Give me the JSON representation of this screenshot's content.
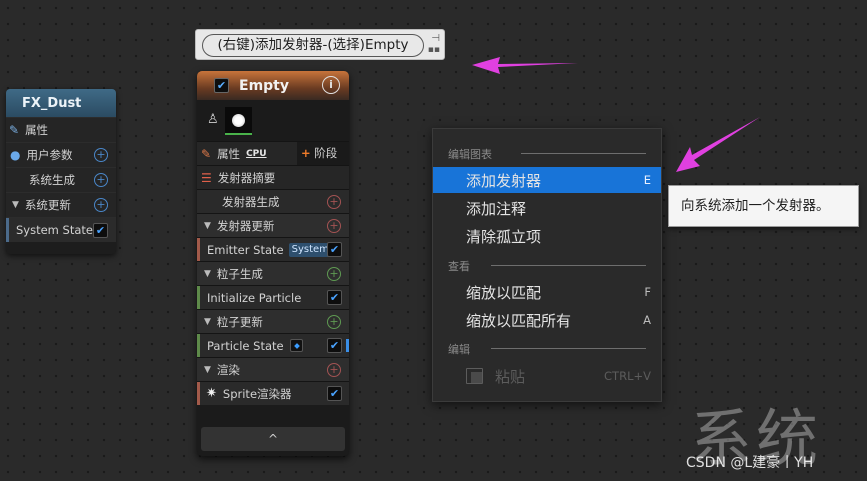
{
  "fx_node": {
    "title": "FX_Dust",
    "rows": [
      {
        "label": "属性",
        "icon": "pencil-icon"
      },
      {
        "label": "用户参数",
        "icon": "user-icon"
      },
      {
        "label": "系统生成"
      },
      {
        "label": "系统更新"
      },
      {
        "label": "System State"
      }
    ]
  },
  "tip_pill": {
    "text": "(右键)添加发射器-(选择)Empty"
  },
  "emitter_node": {
    "title": "Empty",
    "props_label": "属性",
    "cpu_label": "CPU",
    "stage_label": "阶段",
    "summary_label": "发射器摘要",
    "emitter_spawn": "发射器生成",
    "emitter_update": "发射器更新",
    "emitter_state": "Emitter State",
    "system_badge": "System",
    "particle_spawn": "粒子生成",
    "initialize_particle": "Initialize Particle",
    "particle_update": "粒子更新",
    "particle_state": "Particle State",
    "render": "渲染",
    "sprite_renderer": "Sprite渲染器",
    "footer_glyph": "^"
  },
  "context_menu": {
    "sections": [
      {
        "title": "编辑图表",
        "items": [
          {
            "label": "添加发射器",
            "shortcut": "E",
            "selected": true
          },
          {
            "label": "添加注释",
            "shortcut": ""
          },
          {
            "label": "清除孤立项",
            "shortcut": ""
          }
        ]
      },
      {
        "title": "查看",
        "items": [
          {
            "label": "缩放以匹配",
            "shortcut": "F"
          },
          {
            "label": "缩放以匹配所有",
            "shortcut": "A"
          }
        ]
      },
      {
        "title": "编辑",
        "items": [
          {
            "label": "粘贴",
            "shortcut": "CTRL+V",
            "disabled": true
          }
        ]
      }
    ]
  },
  "tooltip": {
    "text": "向系统添加一个发射器。"
  },
  "watermark": {
    "text": "系统",
    "credit": "CSDN @L建豪丨YH"
  },
  "colors": {
    "accent_selected": "#1874d8",
    "arrow": "#e040e0",
    "emitter_header": "#c8743b",
    "system_header": "#3f6a86"
  }
}
